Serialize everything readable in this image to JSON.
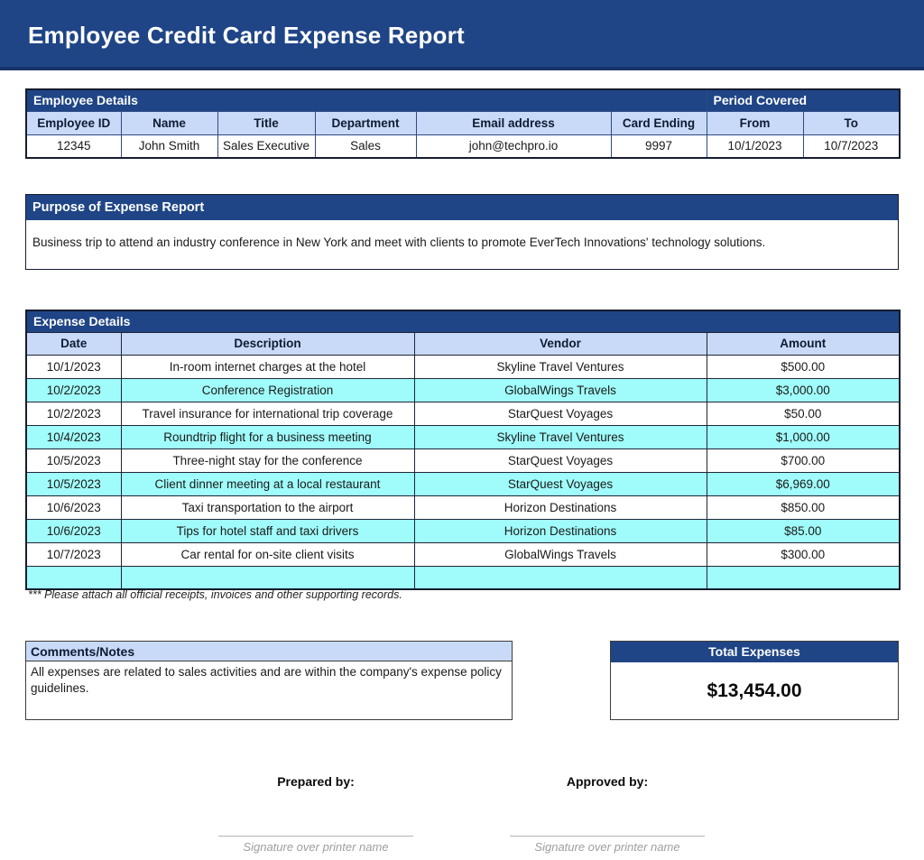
{
  "title": "Employee Credit Card Expense Report",
  "colors": {
    "banner_blue": "#1F4586",
    "banner_border": "#16336B",
    "header_light_blue": "#C9DAF8",
    "row_cyan": "#A0FCFA"
  },
  "employee": {
    "section_label": "Employee Details",
    "period_label": "Period Covered",
    "headers": [
      "Employee ID",
      "Name",
      "Title",
      "Department",
      "Email address",
      "Card Ending",
      "From",
      "To"
    ],
    "values": [
      "12345",
      "John Smith",
      "Sales Executive",
      "Sales",
      "john@techpro.io",
      "9997",
      "10/1/2023",
      "10/7/2023"
    ]
  },
  "purpose": {
    "section_label": "Purpose of Expense Report",
    "text": "Business trip to attend an industry conference in New York and meet with clients to promote EverTech Innovations' technology solutions."
  },
  "expenses": {
    "section_label": "Expense Details",
    "headers": [
      "Date",
      "Description",
      "Vendor",
      "Amount"
    ],
    "rows": [
      {
        "date": "10/1/2023",
        "description": "In-room internet charges at the hotel",
        "vendor": "Skyline Travel Ventures",
        "amount": "$500.00"
      },
      {
        "date": "10/2/2023",
        "description": "Conference Registration",
        "vendor": "GlobalWings Travels",
        "amount": "$3,000.00"
      },
      {
        "date": "10/2/2023",
        "description": "Travel insurance for international trip coverage",
        "vendor": "StarQuest Voyages",
        "amount": "$50.00"
      },
      {
        "date": "10/4/2023",
        "description": "Roundtrip flight for a business meeting",
        "vendor": "Skyline Travel Ventures",
        "amount": "$1,000.00"
      },
      {
        "date": "10/5/2023",
        "description": "Three-night stay for the conference",
        "vendor": "StarQuest Voyages",
        "amount": "$700.00"
      },
      {
        "date": "10/5/2023",
        "description": "Client dinner meeting at a local restaurant",
        "vendor": "StarQuest Voyages",
        "amount": "$6,969.00"
      },
      {
        "date": "10/6/2023",
        "description": "Taxi transportation to the airport",
        "vendor": "Horizon Destinations",
        "amount": "$850.00"
      },
      {
        "date": "10/6/2023",
        "description": "Tips for hotel staff and taxi drivers",
        "vendor": "Horizon Destinations",
        "amount": "$85.00"
      },
      {
        "date": "10/7/2023",
        "description": "Car rental for on-site client visits",
        "vendor": "GlobalWings Travels",
        "amount": "$300.00"
      },
      {
        "date": "",
        "description": "",
        "vendor": "",
        "amount": ""
      }
    ],
    "note": "*** Please attach all official receipts, invoices and other supporting records."
  },
  "comments": {
    "section_label": "Comments/Notes",
    "text": "All expenses are related to sales activities and are within the company's expense policy guidelines."
  },
  "total": {
    "section_label": "Total Expenses",
    "value": "$13,454.00"
  },
  "signatures": {
    "prepared_label": "Prepared by:",
    "approved_label": "Approved by:",
    "caption": "Signature over printer name"
  }
}
